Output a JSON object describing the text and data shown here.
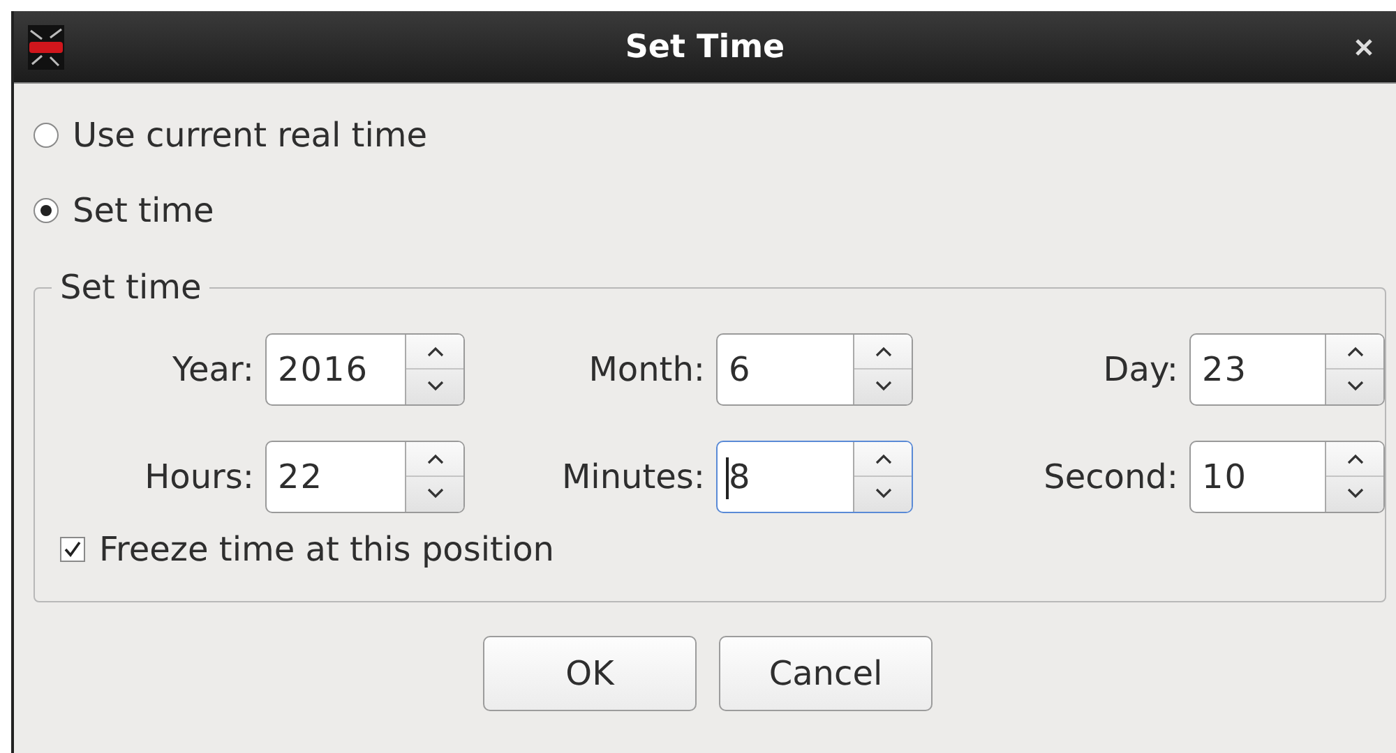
{
  "window": {
    "title": "Set Time"
  },
  "time_mode": [
    {
      "label": "Use current real time",
      "selected": false
    },
    {
      "label": "Set time",
      "selected": true
    }
  ],
  "group": {
    "title": "Set time",
    "rows": [
      [
        {
          "label": "Year:",
          "value": "2016",
          "focused": false
        },
        {
          "label": "Month:",
          "value": "6",
          "focused": false
        },
        {
          "label": "Day:",
          "value": "23",
          "focused": false
        }
      ],
      [
        {
          "label": "Hours:",
          "value": "22",
          "focused": false
        },
        {
          "label": "Minutes:",
          "value": "8",
          "focused": true
        },
        {
          "label": "Second:",
          "value": "10",
          "focused": false
        }
      ]
    ],
    "freeze": {
      "label": "Freeze time at this position",
      "checked": true
    }
  },
  "buttons": [
    "OK",
    "Cancel"
  ]
}
